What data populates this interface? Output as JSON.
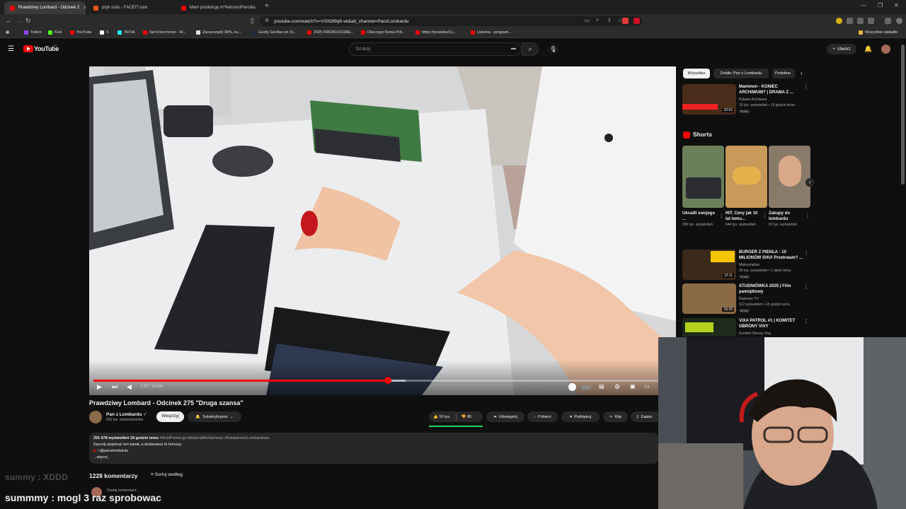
{
  "browser": {
    "tabs": [
      {
        "label": "Prawdziwy Lombard - Odcinek 2",
        "active": true,
        "favicon_color": "#ff0000"
      },
      {
        "label": "pryk stats - FACEIT.com",
        "active": false,
        "favicon_color": "#ff5500"
      },
      {
        "label": "Mam produkcję m*fedronu!Parodia",
        "active": false,
        "favicon_color": "#ff0000"
      }
    ],
    "new_tab": "+",
    "url": "youtube.com/watch?v=VSN3l9q9-vk&ab_channel=PanzLombardu",
    "bookmarks": [
      {
        "label": "Twitch",
        "color": "#9146ff"
      },
      {
        "label": "Kick",
        "color": "#53fc18"
      },
      {
        "label": "YouTube",
        "color": "#ff0000"
      },
      {
        "label": "X",
        "color": "#ffffff"
      },
      {
        "label": "TikTok",
        "color": "#25f4ee"
      },
      {
        "label": "Set Frenchcore - M...",
        "color": "#ff0000"
      },
      {
        "label": "Zaoszczędź 30%, ku...",
        "color": "#e0e0e0"
      },
      {
        "label": "Goofy Gorillas on St...",
        "color": "#1b2838"
      },
      {
        "label": "2025 FRENCHCORE...",
        "color": "#ff0000"
      },
      {
        "label": "Dlaczego Korea Pół...",
        "color": "#ff0000"
      },
      {
        "label": "https://youtube/Cc...",
        "color": "#ff0000"
      },
      {
        "label": "Usterka - program...",
        "color": "#ff0000"
      }
    ],
    "all_bookmarks": "Wszystkie zakładki"
  },
  "youtube": {
    "logo_text": "YouTube",
    "logo_region": "PL",
    "search_placeholder": "Szukaj",
    "create_label": "Utwórz"
  },
  "player": {
    "time_current": "7:37",
    "time_total": "14:56",
    "time_display": "7:37 / 14:56",
    "progress_fraction": 0.51,
    "buffered_fraction": 0.54
  },
  "video": {
    "title": "Prawdziwy Lombard - Odcinek 275 \"Druga szansa\"",
    "channel": "Pan z Lombardu",
    "subscribers": "502 tys. subskrybentów",
    "support_label": "Wesprzyj",
    "subscribed_label": "Subskrybujesz",
    "likes": "10 tys.",
    "dislikes": "85",
    "share_label": "Udostępnij",
    "download_label": "Pobierz",
    "thanks_label": "Podziękuj",
    "clip_label": "Klip",
    "save_label": "Zapisz",
    "desc_stats": "291 678 wyświetleń  18 godzin temu",
    "desc_tags": "#AutoPromocja #MateriałReklamowy #DziałalnośćLombardowa",
    "desc_line1": "Zacznij wspierać ten kanał, a dostaniesz te bonusy:",
    "desc_line2": "/ @panzlombardu",
    "desc_more": "...więcej"
  },
  "comments": {
    "count": "1228 komentarzy",
    "sort_label": "Sortuj według",
    "add_placeholder": "Dodaj komentarz..."
  },
  "sidebar": {
    "chips": [
      "Wszystkie",
      "Źródło: Pan z Lombardu",
      "Podobne"
    ],
    "recs": [
      {
        "title": "Mammon - KONIEC ARCHIWUM? | DRAMA Z ...",
        "channel": "Kulawe Archiwum",
        "meta": "15 tys. wyświetleń • 19 godzin temu",
        "badge": "Nowy",
        "duration": "32:52",
        "thumb_color": "#4a2c1a"
      },
      {
        "title": "BURGER Z PIEKŁA - 10 MILIONÓW SHU! Przetrwam? ...",
        "channel": "Maksymalnie",
        "meta": "34 tys. wyświetleń • 1 dzień temu",
        "badge": "Nowy",
        "duration": "12:11",
        "thumb_color": "#3c2a1a"
      },
      {
        "title": "STUDNIÓWKA 2025 | Film pamiątkowy",
        "channel": "Radosne TV",
        "meta": "112 wyświetleń • 16 godzin temu",
        "badge": "Nowy",
        "duration": "16:42",
        "thumb_color": "#8a6a45"
      },
      {
        "title": "VIXA PATROL #1 | KOMITET OBRONY VIXY",
        "channel": "Komitet Obrony Vixy",
        "meta": "",
        "badge": "",
        "duration": "",
        "thumb_color": "#1e2a1a"
      }
    ],
    "shorts_title": "Shorts",
    "shorts": [
      {
        "title": "Ukradli swojego ...",
        "views": "290 tys. wyświetleń",
        "thumb_color": "#6b7f5a"
      },
      {
        "title": "HIT. Ceny jak 10 lat temu...",
        "views": "644 tys. wyświetleń",
        "thumb_color": "#c79a5a"
      },
      {
        "title": "Zakupy do lombardu",
        "views": "92 tys. wyświetleń",
        "thumb_color": "#8a7a6a"
      }
    ]
  },
  "chat": {
    "line1": "summy : XDDD",
    "line2_user": "summmy :",
    "line2_text": " mogl 3 raz sprobowac"
  }
}
